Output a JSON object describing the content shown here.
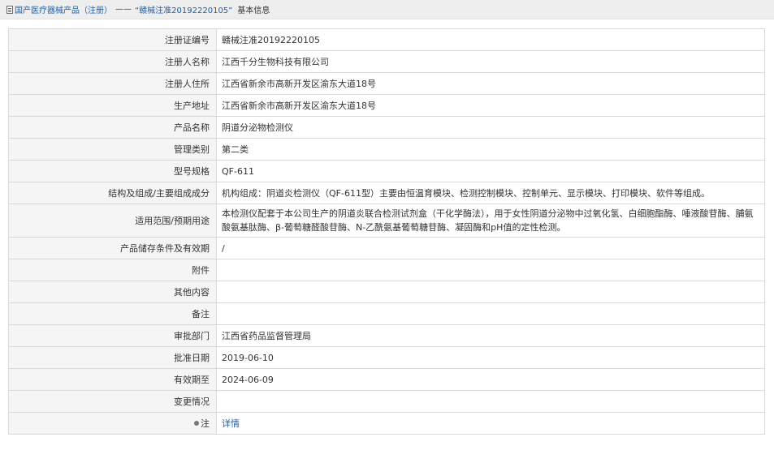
{
  "breadcrumb": {
    "root_label": "国产医疗器械产品（注册）",
    "separator": "——",
    "current_label": "“赣械注准20192220105”",
    "suffix": "基本信息"
  },
  "rows": [
    {
      "label": "注册证编号",
      "value": "赣械注准20192220105"
    },
    {
      "label": "注册人名称",
      "value": "江西千分生物科技有限公司"
    },
    {
      "label": "注册人住所",
      "value": "江西省新余市高新开发区渝东大道18号"
    },
    {
      "label": "生产地址",
      "value": "江西省新余市高新开发区渝东大道18号"
    },
    {
      "label": "产品名称",
      "value": "阴道分泌物检测仪"
    },
    {
      "label": "管理类别",
      "value": "第二类"
    },
    {
      "label": "型号规格",
      "value": "QF-611"
    },
    {
      "label": "结构及组成/主要组成成分",
      "value": "机构组成：阴道炎检测仪（QF-611型）主要由恒温育模块、检测控制模块、控制单元、显示模块、打印模块、软件等组成。"
    },
    {
      "label": "适用范围/预期用途",
      "value": "本检测仪配套于本公司生产的阴道炎联合检测试剂盒（干化学酶法），用于女性阴道分泌物中过氧化氢、白细胞酯酶、唾液酸苷酶、脯氨酸氨基肽酶、β-葡萄糖醛酸苷酶、N-乙酰氨基葡萄糖苷酶、凝固酶和pH值的定性检测。"
    },
    {
      "label": "产品储存条件及有效期",
      "value": "/"
    },
    {
      "label": "附件",
      "value": ""
    },
    {
      "label": "其他内容",
      "value": ""
    },
    {
      "label": "备注",
      "value": ""
    },
    {
      "label": "审批部门",
      "value": "江西省药品监督管理局"
    },
    {
      "label": "批准日期",
      "value": "2019-06-10"
    },
    {
      "label": "有效期至",
      "value": "2024-06-09"
    },
    {
      "label": "变更情况",
      "value": ""
    },
    {
      "label": "注",
      "value": "详情",
      "icon": "pin-icon"
    }
  ],
  "colors": {
    "link": "#1d5ea8",
    "label_bg": "#f5f5f5",
    "border": "#d9d9d9",
    "topbar_bg": "#eeeeee"
  }
}
